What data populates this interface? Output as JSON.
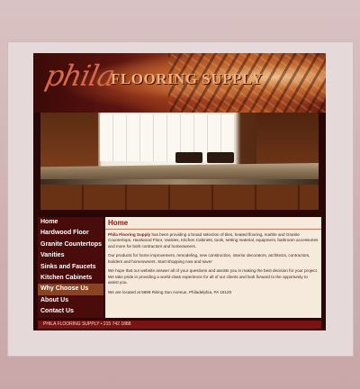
{
  "brand": {
    "logo_script": "phila",
    "logo_text": "FLOORING SUPPLY"
  },
  "nav": {
    "items": [
      {
        "label": "Home"
      },
      {
        "label": "Hardwood Floor"
      },
      {
        "label": "Granite Countertops"
      },
      {
        "label": "Vanities"
      },
      {
        "label": "Sinks and Faucets"
      },
      {
        "label": "Kitchen Cabinets"
      },
      {
        "label": "Why Choose Us"
      },
      {
        "label": "About Us"
      },
      {
        "label": "Contact Us"
      }
    ],
    "active_index": 6
  },
  "content": {
    "title": "Home",
    "brand_name": "Phila Flooring Supply",
    "paragraph1": " has been providing a broad selection of tiles, heated flooring, marble and Granite Countertops, Hardwood Floor, Vanities, Kitchen Cabinets, tools, setting material, equipment, bathroom accessories and more for both contractors and homeowners.",
    "paragraph2": "Our products for home improvement, remodeling, new construction, interior decorators, architects, contractors, builders and homeowners. Start shopping now and save!",
    "paragraph3": "We hope that our website answer all of your questions and assists you in making the best decision for your project. We take pride in providing a world-class experience for all of our clients and look forward to the opportunity to assist you.",
    "paragraph4": "We are located at 5699 Rising Sun Avenue, Philadelphia, PA 19120"
  },
  "footer": {
    "text": "PHILA FLOORING SUPPLY • 215 742 1888"
  },
  "colors": {
    "page_bg": "#d4b8ba",
    "site_bg": "#2a0707",
    "nav_bg": "#4a0c0b",
    "nav_active": "#8a4422",
    "content_bg": "#f5eadb",
    "accent": "#8a1414",
    "footer_bg": "#7a1414"
  }
}
